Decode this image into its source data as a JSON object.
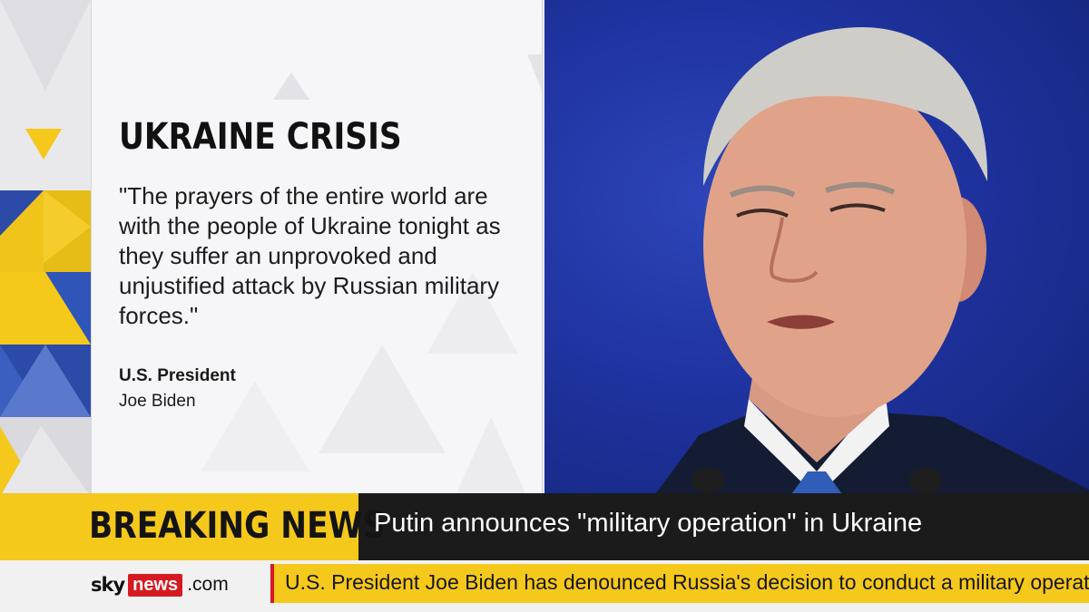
{
  "card": {
    "heading": "UKRAINE CRISIS",
    "quote": "\"The prayers of the entire world are with the people of Ukraine tonight as they suffer an unprovoked and unjustified attack by Russian military forces.\"",
    "attribution_title": "U.S. President",
    "attribution_name": "Joe Biden"
  },
  "breaking": {
    "label": "BREAKING NEWS",
    "headline": "Putin announces \"military operation\" in Ukraine"
  },
  "ticker": {
    "logo_sky": "sky",
    "logo_news": "news",
    "logo_com": ".com",
    "text": "U.S. President Joe Biden has denounced Russia's decision to conduct a military operation in Ukraine"
  },
  "colors": {
    "accent_yellow": "#f5c81c",
    "accent_blue": "#1f33a0",
    "brand_red": "#d71921",
    "bar_dark": "#1b1b1b"
  },
  "photo": {
    "subject": "portrait of a speaker in front of a blue backdrop"
  }
}
